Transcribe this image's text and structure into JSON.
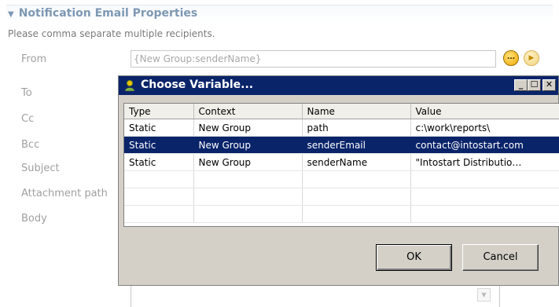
{
  "section": {
    "title": "Notification Email Properties",
    "hint": "Please comma separate multiple recipients."
  },
  "fields": {
    "from_label": "From",
    "from_value": "{New Group:senderName}",
    "to_label": "To",
    "cc_label": "Cc",
    "bcc_label": "Bcc",
    "subject_label": "Subject",
    "attachment_label": "Attachment path",
    "body_label": "Body"
  },
  "dialog": {
    "title": "Choose Variable...",
    "minimize": "_",
    "maximize": "☐",
    "close": "✕",
    "columns": [
      "Type",
      "Context",
      "Name",
      "Value"
    ],
    "rows": [
      {
        "type": "Static",
        "context": "New Group",
        "name": "path",
        "value": "c:\\work\\reports\\",
        "selected": false
      },
      {
        "type": "Static",
        "context": "New Group",
        "name": "senderEmail",
        "value": "contact@intostart.com",
        "selected": true
      },
      {
        "type": "Static",
        "context": "New Group",
        "name": "senderName",
        "value": "\"Intostart Distributio…",
        "selected": false
      }
    ],
    "ok_label": "OK",
    "cancel_label": "Cancel"
  },
  "colors": {
    "titlebar": "#0a246a",
    "selection": "#0a246a",
    "section_title": "#7d98b3"
  },
  "icons": {
    "section_toggle": "triangle-down-icon",
    "variable_button": "ellipsis-circle-icon",
    "arrow_button": "play-circle-icon",
    "dialog_icon": "variable-icon"
  }
}
